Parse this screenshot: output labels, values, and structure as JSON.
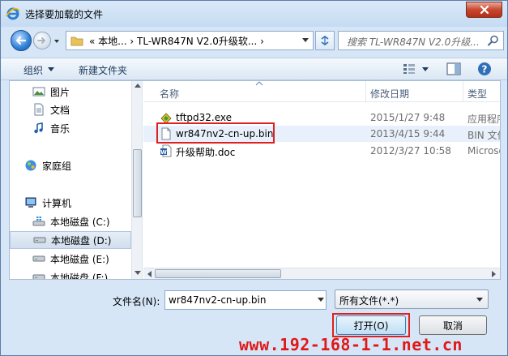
{
  "window": {
    "title": "选择要加载的文件",
    "close_label": "关闭"
  },
  "address_bar": {
    "path": "«  本地...  ›  TL-WR847N V2.0升级软...  ›"
  },
  "search": {
    "placeholder": "搜索 TL-WR847N V2.0升级..."
  },
  "toolbar": {
    "organize": "组织",
    "new_folder": "新建文件夹"
  },
  "nav_pane": {
    "items": [
      {
        "label": "图片",
        "icon": "pictures-icon"
      },
      {
        "label": "文档",
        "icon": "documents-icon"
      },
      {
        "label": "音乐",
        "icon": "music-icon"
      },
      {
        "label": "家庭组",
        "icon": "homegroup-icon"
      },
      {
        "label": "计算机",
        "icon": "computer-icon"
      },
      {
        "label": "本地磁盘 (C:)",
        "icon": "drive-c-icon"
      },
      {
        "label": "本地磁盘 (D:)",
        "icon": "drive-icon"
      },
      {
        "label": "本地磁盘 (E:)",
        "icon": "drive-icon"
      },
      {
        "label": "本地磁盘 (F:)",
        "icon": "drive-icon"
      }
    ]
  },
  "file_list": {
    "columns": {
      "name": "名称",
      "modified": "修改日期",
      "type": "类型"
    },
    "rows": [
      {
        "name": "tftpd32.exe",
        "modified": "2015/1/27 9:48",
        "type": "应用程序",
        "icon": "exe-icon"
      },
      {
        "name": "wr847nv2-cn-up.bin",
        "modified": "2013/4/15 9:44",
        "type": "BIN 文件",
        "icon": "file-icon"
      },
      {
        "name": "升级帮助.doc",
        "modified": "2012/3/27 10:58",
        "type": "Microsoft",
        "icon": "word-doc-icon"
      }
    ]
  },
  "filename": {
    "label": "文件名(N):",
    "value": "wr847nv2-cn-up.bin"
  },
  "filetype": {
    "selected": "所有文件(*.*)"
  },
  "buttons": {
    "open": "打开(O)",
    "cancel": "取消"
  },
  "watermark": "www.192-168-1-1.net.cn",
  "colors": {
    "highlight_box": "#e02020",
    "selected_row": "#e8f1fb",
    "window_frame": "#d6e6f7"
  }
}
